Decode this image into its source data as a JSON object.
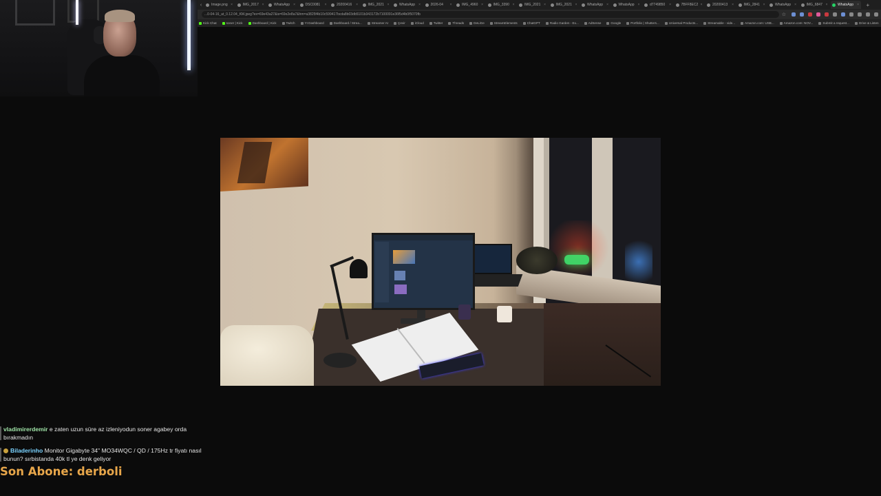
{
  "browser": {
    "tabs": [
      {
        "label": "Image.png"
      },
      {
        "label": "IMG_2017"
      },
      {
        "label": "WhatsApp"
      },
      {
        "label": "DSC0081"
      },
      {
        "label": "20200416"
      },
      {
        "label": "IMG_2021"
      },
      {
        "label": "WhatsApp"
      },
      {
        "label": "2026-04"
      },
      {
        "label": "IMG_4960"
      },
      {
        "label": "IMG_3390"
      },
      {
        "label": "IMG_2021"
      },
      {
        "label": "IMG_2021"
      },
      {
        "label": "WhatsApp"
      },
      {
        "label": "WhatsApp"
      },
      {
        "label": "d7749850"
      },
      {
        "label": "7BFF8EC2"
      },
      {
        "label": "20200413"
      },
      {
        "label": "IMG_2841"
      },
      {
        "label": "WhatsApp"
      },
      {
        "label": "IMG_6847"
      },
      {
        "label": "WhatsApp"
      }
    ],
    "url": "...0-04-16_at_0.12.04_KM.jpeg?ex=69e43a27&is=69e2e8a7&hm=a3825f4b10c599417bcda8b03db5101b343172b7100091e36f5d4b0f5070fb",
    "bookmarks": [
      {
        "label": "Kick Chat",
        "kind": "kick"
      },
      {
        "label": "soner | Kick",
        "kind": "kick"
      },
      {
        "label": "Dashboard | Kick",
        "kind": "kick"
      },
      {
        "label": "Twitch",
        "kind": "other"
      },
      {
        "label": "Yt Dashboard",
        "kind": "other"
      },
      {
        "label": "Dashboard / Strea...",
        "kind": "other"
      },
      {
        "label": "Streamer AI",
        "kind": "other"
      },
      {
        "label": "Çevir",
        "kind": "other"
      },
      {
        "label": "iCloud",
        "kind": "other"
      },
      {
        "label": "Twitter",
        "kind": "other"
      },
      {
        "label": "Threads",
        "kind": "other"
      },
      {
        "label": "DeLiGe",
        "kind": "other"
      },
      {
        "label": "StreamElements",
        "kind": "other"
      },
      {
        "label": "ChatGPT",
        "kind": "other"
      },
      {
        "label": "Radio Garden - Ex...",
        "kind": "other"
      },
      {
        "label": "AdSense",
        "kind": "other"
      },
      {
        "label": "Google",
        "kind": "other"
      },
      {
        "label": "Portfolio | Shutters...",
        "kind": "other"
      },
      {
        "label": "Universal Products...",
        "kind": "other"
      },
      {
        "label": "Streamable - vide...",
        "kind": "other"
      },
      {
        "label": "Amazon.com: USB...",
        "kind": "other"
      },
      {
        "label": "Amazon.com: NOV...",
        "kind": "other"
      },
      {
        "label": "Submit a request...",
        "kind": "other"
      },
      {
        "label": "Drive & Listen",
        "kind": "other"
      }
    ],
    "other_bookmarks": "Tüm Yer İşaretleri"
  },
  "chat": {
    "messages": [
      {
        "user": "vladimirerdemir",
        "text": " e zaten uzun süre az izleniyodun soner agabey orda bırakmadın"
      },
      {
        "user": "Biladerinho",
        "text": " Monitor Gigabyte 34\" MO34WQC / QD / 175Hz tr fiyatı nasıl bunun? sırbistanda 40k tl ye denk geliyor"
      }
    ]
  },
  "overlay": {
    "last_subscriber": "Son Abone: derboli"
  },
  "colors": {
    "background": "#0b0b0b",
    "chat_user_blue": "#7bd3ff",
    "chat_user_green": "#9fe3a7",
    "last_sub": "#e7a64a"
  }
}
